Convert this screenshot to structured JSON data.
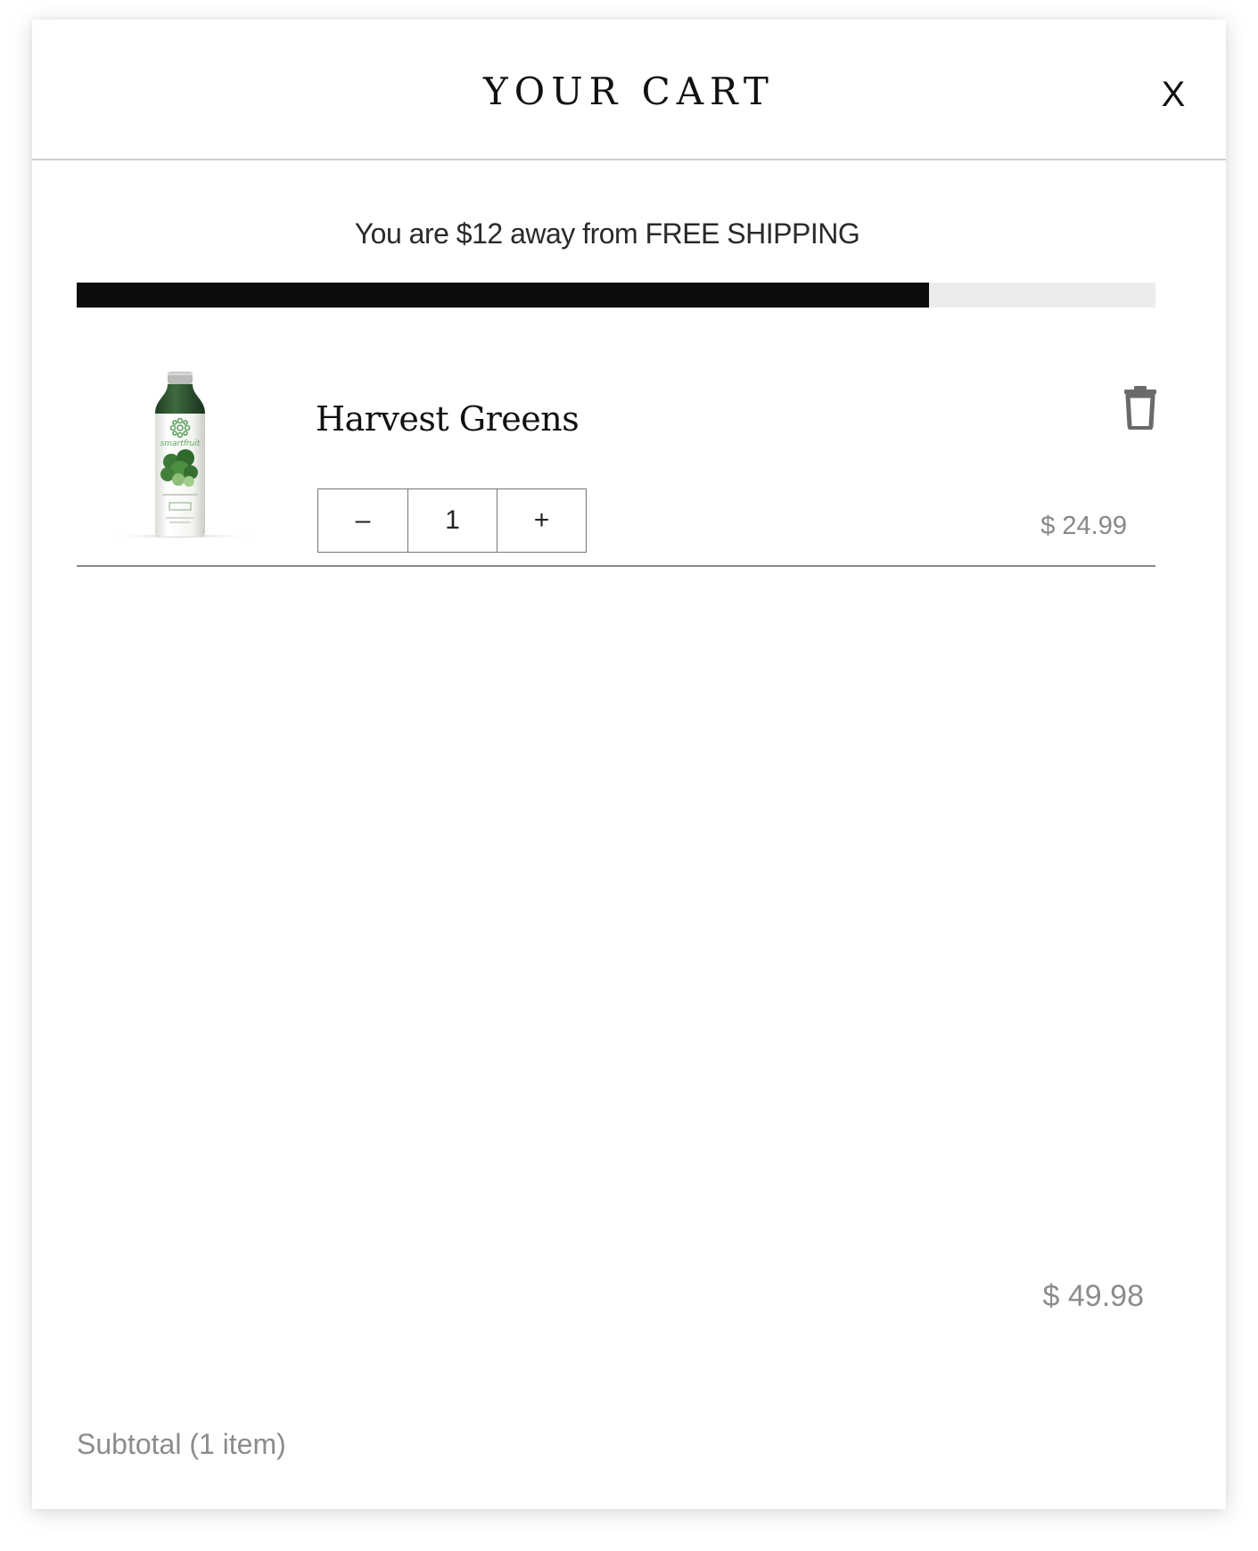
{
  "header": {
    "title": "YOUR CART",
    "close_label": "X"
  },
  "shipping": {
    "message": "You are $12 away from FREE SHIPPING",
    "progress_fraction": 0.79,
    "fill_color": "#0d0d0d",
    "track_color": "#ececec"
  },
  "items": [
    {
      "name": "Harvest Greens",
      "image_icon": "juice-bottle-image",
      "image_brand_text": "smartfruit",
      "quantity": "1",
      "decrement_label": "–",
      "increment_label": "+",
      "price": "$ 24.99",
      "delete_icon": "trash-icon"
    }
  ],
  "summary": {
    "total": "$ 49.98",
    "subtotal_label": "Subtotal (1 item)"
  }
}
